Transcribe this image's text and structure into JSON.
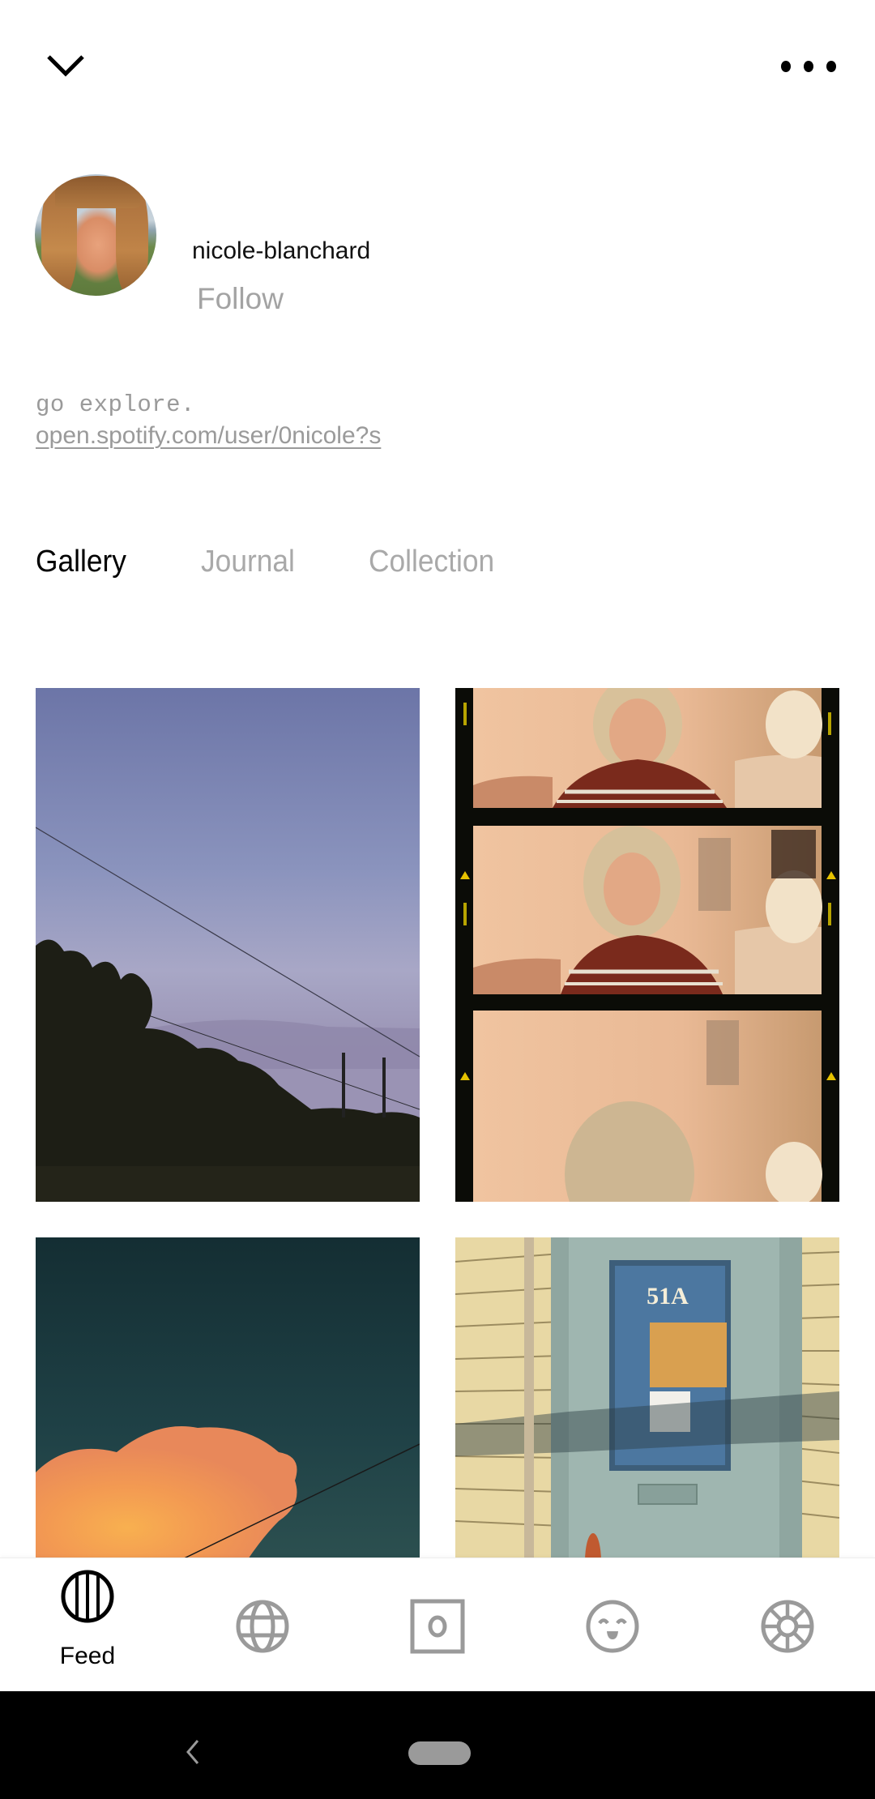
{
  "header": {
    "collapse_icon": "chevron-down-icon",
    "more_icon": "more-horizontal-icon"
  },
  "profile": {
    "username": "nicole-blanchard",
    "follow_label": "Follow",
    "bio": "go explore.",
    "link": "open.spotify.com/user/0nicole?s"
  },
  "tabs": [
    {
      "label": "Gallery",
      "active": true
    },
    {
      "label": "Journal",
      "active": false
    },
    {
      "label": "Collection",
      "active": false
    }
  ],
  "gallery": [
    {
      "description": "dusk sky with trees and power lines"
    },
    {
      "description": "film strip portraits of blonde woman in striped sweater"
    },
    {
      "description": "orange sunset cloud against teal sky"
    },
    {
      "description": "blue door with 51A window on yellow siding"
    }
  ],
  "bottom_nav": [
    {
      "icon": "feed-icon",
      "label": "Feed",
      "active": true
    },
    {
      "icon": "globe-icon",
      "label": "",
      "active": false
    },
    {
      "icon": "camera-icon",
      "label": "",
      "active": false
    },
    {
      "icon": "smile-icon",
      "label": "",
      "active": false
    },
    {
      "icon": "wheel-icon",
      "label": "",
      "active": false
    }
  ],
  "colors": {
    "active": "#000000",
    "inactive": "#9a9a9a",
    "muted_text": "#a3a3a3"
  },
  "system_nav": {
    "back_icon": "back-icon",
    "home_icon": "home-pill-icon"
  }
}
